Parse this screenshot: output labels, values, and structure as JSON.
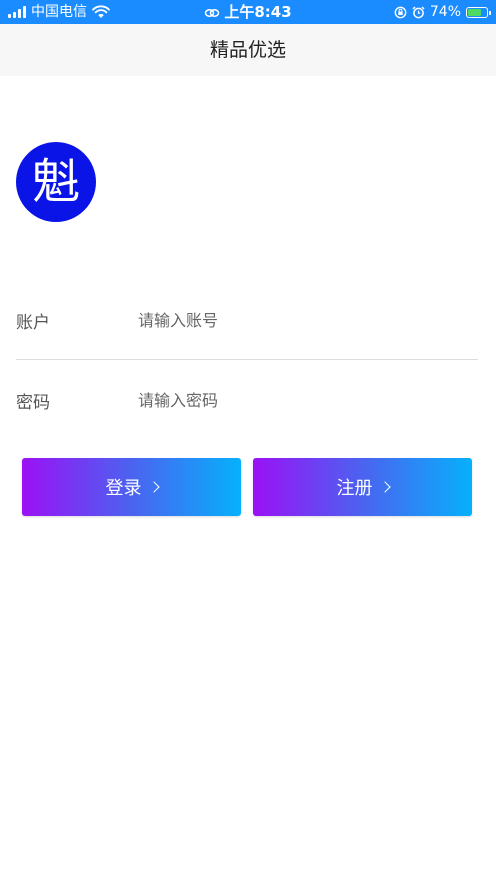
{
  "status_bar": {
    "carrier": "中国电信",
    "time": "上午8:43",
    "battery_percent": "74%",
    "battery_level": 0.74,
    "signal_icon": "signal-icon",
    "wifi_icon": "wifi-icon",
    "link_icon": "link-icon",
    "alarm_icon": "alarm-icon",
    "lock_icon": "rotation-lock-icon",
    "bar_color": "#1a8cff"
  },
  "nav": {
    "title": "精品优选"
  },
  "logo": {
    "text": "魁",
    "color": "#0a14e6"
  },
  "form": {
    "account": {
      "label": "账户",
      "placeholder": "请输入账号",
      "value": ""
    },
    "password": {
      "label": "密码",
      "placeholder": "请输入密码",
      "value": ""
    }
  },
  "buttons": {
    "login_label": "登录",
    "register_label": "注册",
    "gradient_start": "#9b11f5",
    "gradient_end": "#06b1fb"
  }
}
